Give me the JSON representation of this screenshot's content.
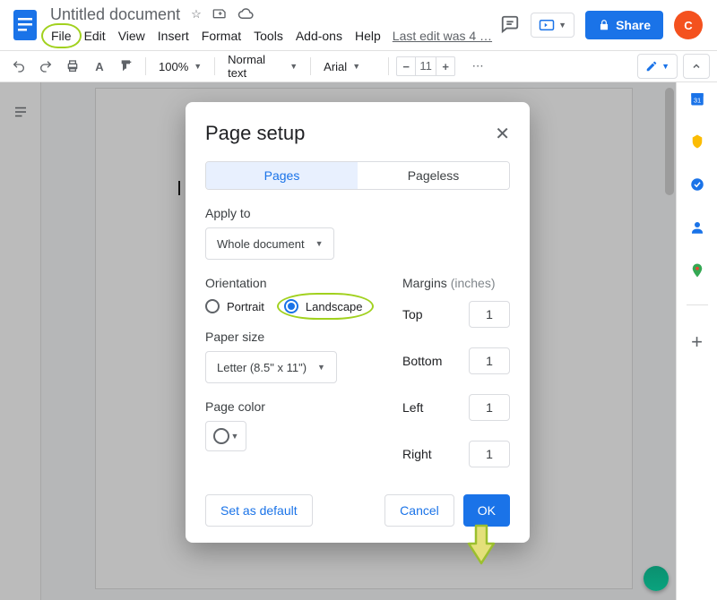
{
  "header": {
    "doc_title": "Untitled document",
    "menu": [
      "File",
      "Edit",
      "View",
      "Insert",
      "Format",
      "Tools",
      "Add-ons",
      "Help"
    ],
    "last_edit": "Last edit was 4 …",
    "share_label": "Share",
    "avatar_initial": "C"
  },
  "toolbar": {
    "zoom": "100%",
    "style": "Normal text",
    "font": "Arial",
    "size": "11"
  },
  "dialog": {
    "title": "Page setup",
    "tabs": {
      "pages": "Pages",
      "pageless": "Pageless"
    },
    "apply_to": {
      "label": "Apply to",
      "value": "Whole document"
    },
    "orientation": {
      "label": "Orientation",
      "portrait": "Portrait",
      "landscape": "Landscape"
    },
    "paper_size": {
      "label": "Paper size",
      "value": "Letter (8.5\" x 11\")"
    },
    "page_color": {
      "label": "Page color"
    },
    "margins": {
      "label": "Margins",
      "unit": "(inches)",
      "top_lbl": "Top",
      "bottom_lbl": "Bottom",
      "left_lbl": "Left",
      "right_lbl": "Right",
      "top": "1",
      "bottom": "1",
      "left": "1",
      "right": "1"
    },
    "set_default": "Set as default",
    "cancel": "Cancel",
    "ok": "OK"
  }
}
